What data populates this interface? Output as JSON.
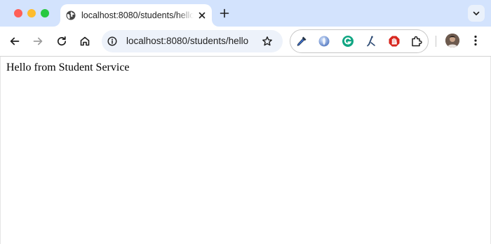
{
  "window": {
    "controls": [
      "close",
      "minimize",
      "maximize"
    ]
  },
  "tab": {
    "title": "localhost:8080/students/hello",
    "icon": "globe-icon"
  },
  "toolbar": {
    "url": "localhost:8080/students/hello",
    "extensions": [
      "eyedropper-icon",
      "blue-orb-extension-icon",
      "grammarly-icon",
      "stylus-pen-icon",
      "stop-hand-icon",
      "puzzle-icon"
    ]
  },
  "page": {
    "text": "Hello from Student Service"
  },
  "colors": {
    "tabstrip": "#d3e3fd",
    "omnibox": "#edf2fa",
    "close": "#ff5f57",
    "minimize": "#febc2e",
    "maximize": "#28c840"
  }
}
